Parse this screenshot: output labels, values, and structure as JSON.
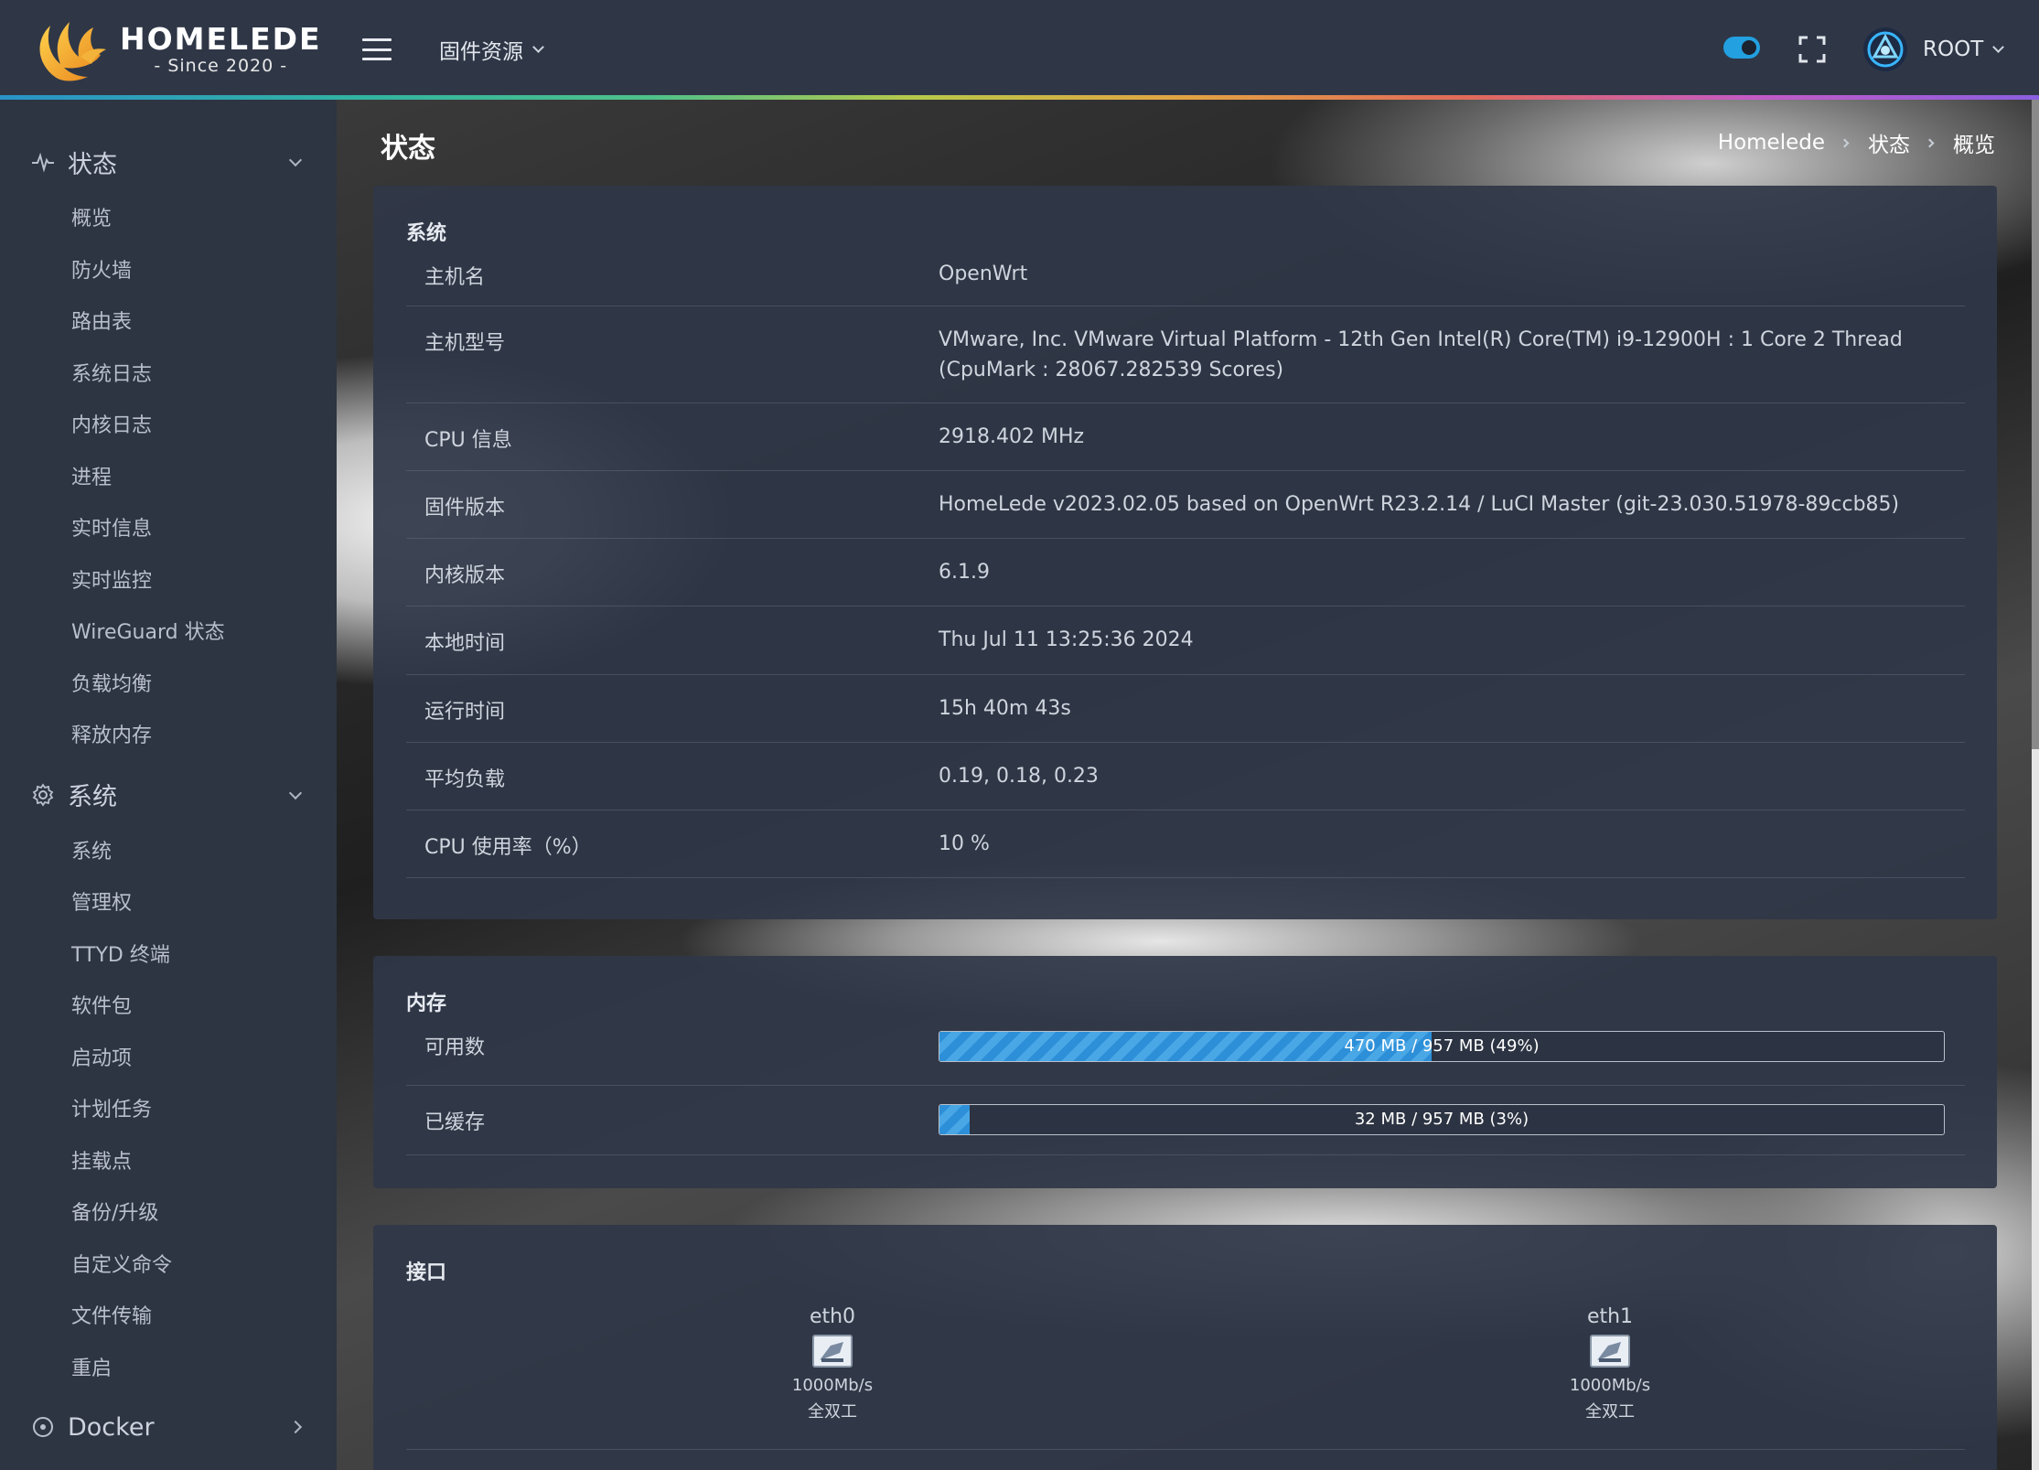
{
  "brand": {
    "name": "HOMELEDE",
    "since": "- Since 2020 -"
  },
  "header": {
    "firmware_menu": "固件资源",
    "user": "ROOT"
  },
  "sidebar": {
    "groups": [
      {
        "label": "状态",
        "icon": "pulse-icon",
        "items": [
          "概览",
          "防火墙",
          "路由表",
          "系统日志",
          "内核日志",
          "进程",
          "实时信息",
          "实时监控",
          "WireGuard 状态",
          "负载均衡",
          "释放内存"
        ]
      },
      {
        "label": "系统",
        "icon": "gear-icon",
        "items": [
          "系统",
          "管理权",
          "TTYD 终端",
          "软件包",
          "启动项",
          "计划任务",
          "挂载点",
          "备份/升级",
          "自定义命令",
          "文件传输",
          "重启"
        ]
      },
      {
        "label": "Docker",
        "icon": "docker-icon",
        "items": []
      }
    ]
  },
  "page": {
    "title": "状态",
    "breadcrumb": [
      "Homelede",
      "状态",
      "概览"
    ]
  },
  "system": {
    "title": "系统",
    "rows": [
      {
        "key": "主机名",
        "value": "OpenWrt"
      },
      {
        "key": "主机型号",
        "value": "VMware, Inc. VMware Virtual Platform - 12th Gen Intel(R) Core(TM) i9-12900H : 1 Core 2 Thread (CpuMark : 28067.282539 Scores)"
      },
      {
        "key": "CPU 信息",
        "value": "2918.402 MHz"
      },
      {
        "key": "固件版本",
        "value": "HomeLede v2023.02.05 based on OpenWrt R23.2.14 / LuCI Master (git-23.030.51978-89ccb85)"
      },
      {
        "key": "内核版本",
        "value": "6.1.9"
      },
      {
        "key": "本地时间",
        "value": "Thu Jul 11 13:25:36 2024"
      },
      {
        "key": "运行时间",
        "value": "15h 40m 43s"
      },
      {
        "key": "平均负载",
        "value": "0.19, 0.18, 0.23"
      },
      {
        "key": "CPU 使用率（%）",
        "value": "10 %"
      }
    ]
  },
  "memory": {
    "title": "内存",
    "rows": [
      {
        "key": "可用数",
        "text": "470 MB / 957 MB (49%)",
        "percent": 49
      },
      {
        "key": "已缓存",
        "text": "32 MB / 957 MB (3%)",
        "percent": 3
      }
    ]
  },
  "interfaces": {
    "title": "接口",
    "items": [
      {
        "name": "eth0",
        "speed": "1000Mb/s",
        "duplex": "全双工",
        "icon": "ethernet-port-icon"
      },
      {
        "name": "eth1",
        "speed": "1000Mb/s",
        "duplex": "全双工",
        "icon": "ethernet-port-icon"
      }
    ]
  },
  "colors": {
    "accent": "#22a0e0",
    "progress_stripe_a": "#2c8fd8",
    "progress_stripe_b": "#4aa7e6",
    "panel": "#2f3747"
  }
}
